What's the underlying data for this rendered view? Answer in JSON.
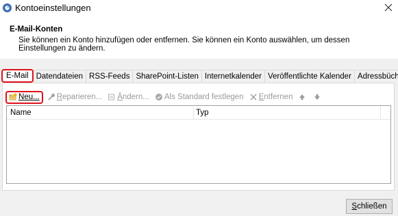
{
  "window": {
    "title": "Kontoeinstellungen"
  },
  "header": {
    "title": "E-Mail-Konten",
    "description": "Sie können ein Konto hinzufügen oder entfernen. Sie können ein Konto auswählen, um dessen Einstellungen zu ändern."
  },
  "tabs": [
    {
      "label": "E-Mail",
      "active": true
    },
    {
      "label": "Datendateien"
    },
    {
      "label": "RSS-Feeds"
    },
    {
      "label": "SharePoint-Listen"
    },
    {
      "label": "Internetkalender"
    },
    {
      "label": "Veröffentlichte Kalender"
    },
    {
      "label": "Adressbücher"
    }
  ],
  "toolbar": {
    "new_label_u": "N",
    "new_label_rest": "eu...",
    "repair_label_u": "R",
    "repair_label_rest": "eparieren...",
    "change_label_u": "Ä",
    "change_label_rest": "ndern...",
    "default_label": "Als Standard festlegen",
    "remove_label_u": "E",
    "remove_label_rest": "ntfernen",
    "up_icon": "arrow-up-icon",
    "down_icon": "arrow-down-icon"
  },
  "list": {
    "columns": [
      "Name",
      "Typ"
    ],
    "rows": []
  },
  "footer": {
    "close_label_u": "S",
    "close_label_rest": "chließen"
  },
  "colors": {
    "highlight": "#e0101a",
    "panel": "#f0f0f0",
    "disabled_text": "#9a9a9a"
  }
}
